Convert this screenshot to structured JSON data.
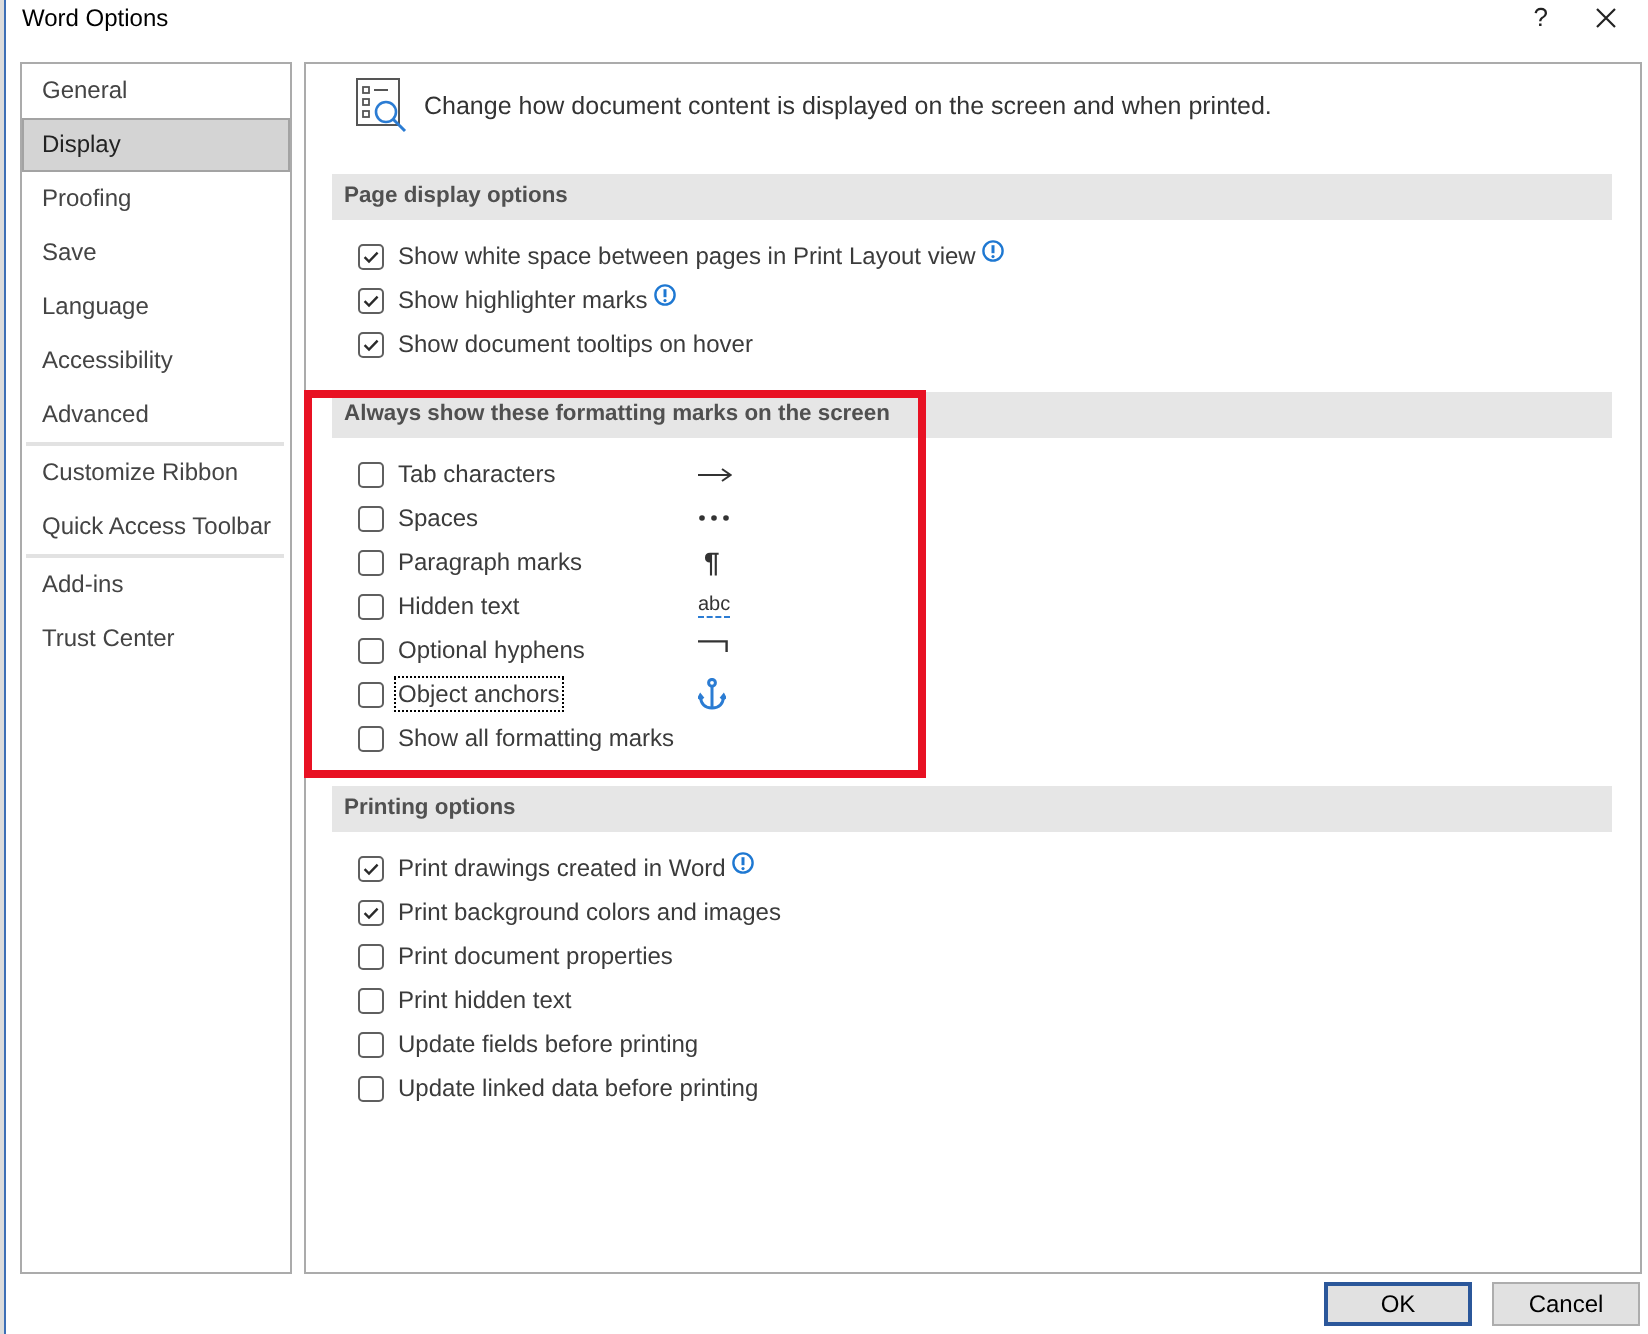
{
  "window": {
    "title": "Word Options",
    "help": "?"
  },
  "sidebar": {
    "groups": [
      {
        "items": [
          {
            "label": "General",
            "selected": false
          },
          {
            "label": "Display",
            "selected": true
          },
          {
            "label": "Proofing",
            "selected": false
          },
          {
            "label": "Save",
            "selected": false
          },
          {
            "label": "Language",
            "selected": false
          },
          {
            "label": "Accessibility",
            "selected": false
          },
          {
            "label": "Advanced",
            "selected": false
          }
        ]
      },
      {
        "items": [
          {
            "label": "Customize Ribbon",
            "selected": false
          },
          {
            "label": "Quick Access Toolbar",
            "selected": false
          }
        ]
      },
      {
        "items": [
          {
            "label": "Add-ins",
            "selected": false
          },
          {
            "label": "Trust Center",
            "selected": false
          }
        ]
      }
    ]
  },
  "header": {
    "text": "Change how document content is displayed on the screen and when printed."
  },
  "sections": [
    {
      "title": "Page display options",
      "highlighted": false,
      "items": [
        {
          "label": "Show white space between pages in Print Layout view",
          "checked": true,
          "info": true,
          "focused": false
        },
        {
          "label": "Show highlighter marks",
          "checked": true,
          "info": true,
          "focused": false
        },
        {
          "label": "Show document tooltips on hover",
          "checked": true,
          "info": false,
          "focused": false
        }
      ]
    },
    {
      "title": "Always show these formatting marks on the screen",
      "highlighted": true,
      "items": [
        {
          "label": "Tab characters",
          "checked": false,
          "info": false,
          "focused": false,
          "symbol": {
            "kind": "arrow"
          }
        },
        {
          "label": "Spaces",
          "checked": false,
          "info": false,
          "focused": false,
          "symbol": {
            "kind": "dots"
          }
        },
        {
          "label": "Paragraph marks",
          "checked": false,
          "info": false,
          "focused": false,
          "symbol": {
            "kind": "pilcrow",
            "text": "¶"
          }
        },
        {
          "label": "Hidden text",
          "checked": false,
          "info": false,
          "focused": false,
          "symbol": {
            "kind": "hidden_text",
            "text": "abc"
          }
        },
        {
          "label": "Optional hyphens",
          "checked": false,
          "info": false,
          "focused": false,
          "symbol": {
            "kind": "hyphen"
          }
        },
        {
          "label": "Object anchors",
          "checked": false,
          "info": false,
          "focused": true,
          "symbol": {
            "kind": "anchor"
          }
        },
        {
          "label": "Show all formatting marks",
          "checked": false,
          "info": false,
          "focused": false
        }
      ]
    },
    {
      "title": "Printing options",
      "highlighted": false,
      "items": [
        {
          "label": "Print drawings created in Word",
          "checked": true,
          "info": true,
          "focused": false
        },
        {
          "label": "Print background colors and images",
          "checked": true,
          "info": false,
          "focused": false
        },
        {
          "label": "Print document properties",
          "checked": false,
          "info": false,
          "focused": false
        },
        {
          "label": "Print hidden text",
          "checked": false,
          "info": false,
          "focused": false
        },
        {
          "label": "Update fields before printing",
          "checked": false,
          "info": false,
          "focused": false
        },
        {
          "label": "Update linked data before printing",
          "checked": false,
          "info": false,
          "focused": false
        }
      ]
    }
  ],
  "buttons": [
    {
      "label": "OK",
      "default": true
    },
    {
      "label": "Cancel",
      "default": false
    }
  ]
}
